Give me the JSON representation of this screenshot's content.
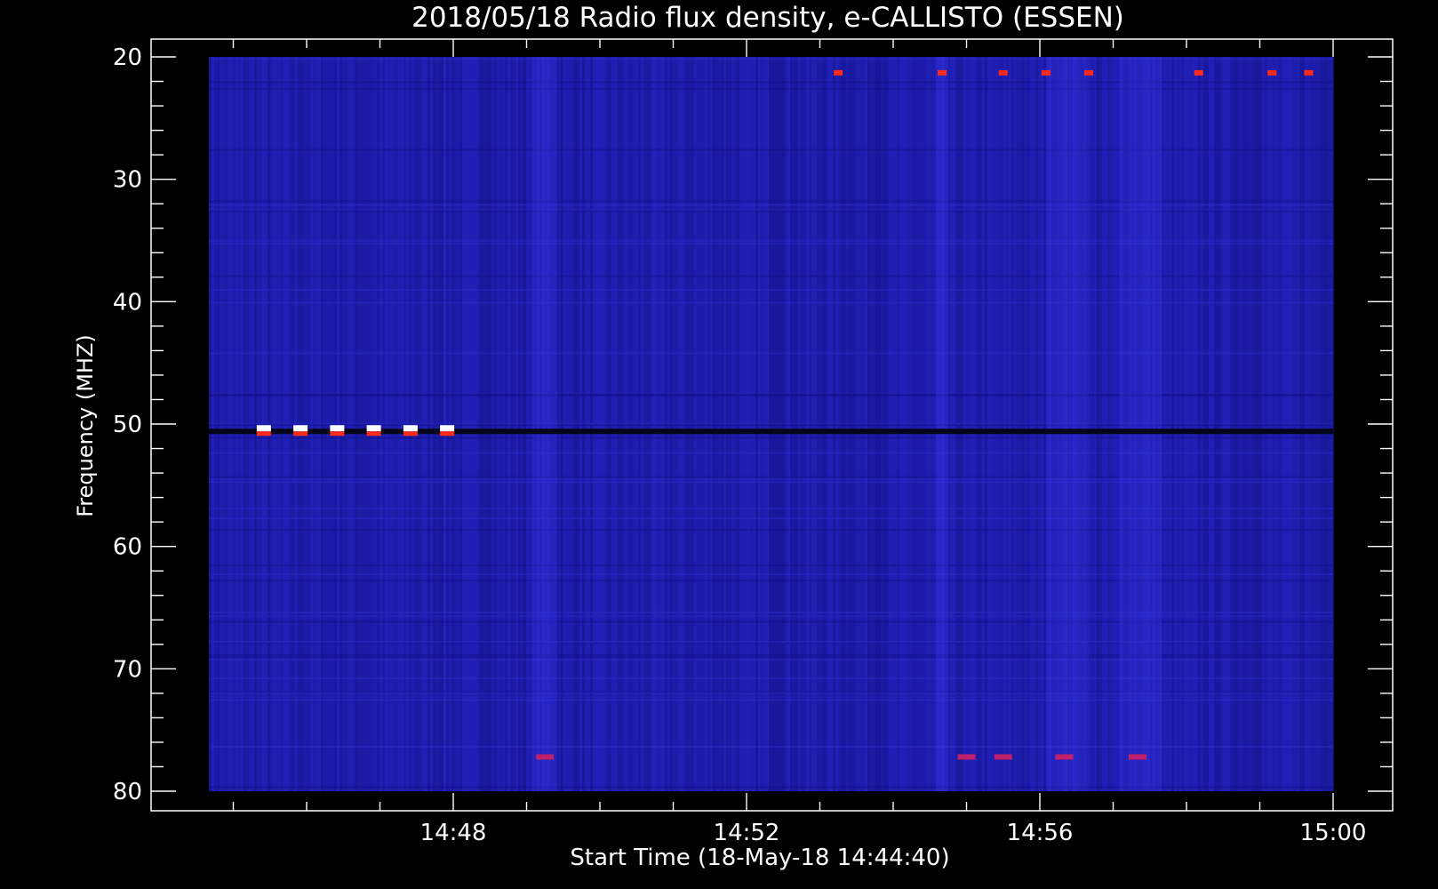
{
  "chart_data": {
    "type": "heatmap",
    "title": "2018/05/18  Radio flux density, e-CALLISTO (ESSEN)",
    "xlabel": "Start Time (18-May-18 14:44:40)",
    "ylabel": "Frequency (MHZ)",
    "x_start": "14:44:40",
    "x_end": "15:00:00",
    "x_ticks": [
      "14:48",
      "14:52",
      "14:56",
      "15:00"
    ],
    "y_ticks": [
      20,
      30,
      40,
      50,
      60,
      70,
      80
    ],
    "ylim": [
      80,
      20
    ],
    "y_axis_inverted": true,
    "colors": {
      "background": "#000000",
      "axes": "#ffffff",
      "low": "#1a1aa6",
      "high": "#ff2a1a",
      "peak": "#ffffff"
    },
    "features": {
      "dark_line_freq_mhz": 50.6,
      "strong_bursts": {
        "freq_mhz": 50.6,
        "times": [
          "14:45:25",
          "14:45:55",
          "14:46:25",
          "14:46:55",
          "14:47:25",
          "14:47:55"
        ]
      },
      "bright_bands": [
        {
          "start": "14:49:05",
          "end": "14:49:25"
        },
        {
          "start": "14:54:35",
          "end": "14:54:45"
        },
        {
          "start": "14:56:05",
          "end": "14:56:40"
        },
        {
          "start": "14:57:05",
          "end": "14:57:40"
        }
      ],
      "red_spots_21mhz": [
        "14:53:15",
        "14:54:40",
        "14:55:30",
        "14:56:05",
        "14:56:40",
        "14:58:10",
        "14:59:10",
        "14:59:40"
      ],
      "red_spots_77mhz": [
        "14:49:15",
        "14:55:00",
        "14:55:30",
        "14:56:20",
        "14:57:20"
      ]
    }
  }
}
